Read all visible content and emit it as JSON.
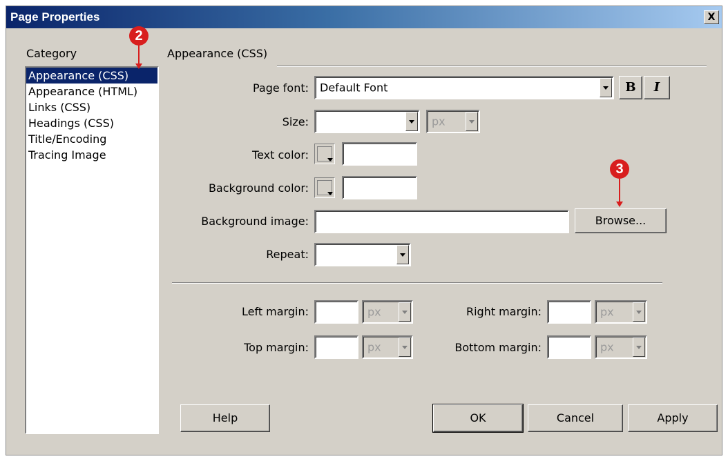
{
  "window": {
    "title": "Page Properties",
    "close_label": "X"
  },
  "category": {
    "label": "Category",
    "items": [
      "Appearance (CSS)",
      "Appearance (HTML)",
      "Links (CSS)",
      "Headings (CSS)",
      "Title/Encoding",
      "Tracing Image"
    ],
    "selected_index": 0
  },
  "section": {
    "title": "Appearance (CSS)"
  },
  "form": {
    "page_font_label": "Page font:",
    "page_font_value": "Default Font",
    "bold_label": "B",
    "italic_label": "I",
    "size_label": "Size:",
    "size_value": "",
    "size_unit": "px",
    "text_color_label": "Text color:",
    "text_color_value": "",
    "bg_color_label": "Background color:",
    "bg_color_value": "",
    "bg_image_label": "Background image:",
    "bg_image_value": "",
    "browse_label": "Browse...",
    "repeat_label": "Repeat:",
    "repeat_value": "",
    "left_margin_label": "Left margin:",
    "right_margin_label": "Right margin:",
    "top_margin_label": "Top margin:",
    "bottom_margin_label": "Bottom margin:",
    "margin_unit": "px"
  },
  "buttons": {
    "help": "Help",
    "ok": "OK",
    "cancel": "Cancel",
    "apply": "Apply"
  },
  "annotations": {
    "badge_2": "2",
    "badge_3": "3"
  },
  "colors": {
    "titlebar_start": "#0a246a",
    "titlebar_end": "#a6caf0",
    "dialog_bg": "#d4d0c8",
    "selection": "#0a246a",
    "annotation_red": "#d81e1e"
  }
}
